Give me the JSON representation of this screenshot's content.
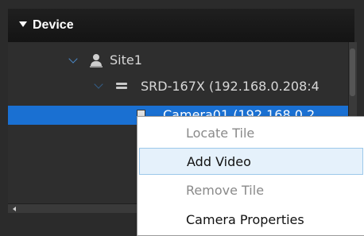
{
  "panel": {
    "title": "Device"
  },
  "tree": {
    "site": {
      "label": "Site1"
    },
    "recorder": {
      "label": "SRD-167X (192.168.0.208:4"
    },
    "camera": {
      "label": "Camera01 (192.168.0.2"
    }
  },
  "context_menu": {
    "items": [
      {
        "label": "Locate Tile",
        "enabled": false
      },
      {
        "label": "Add Video",
        "enabled": true,
        "highlighted": true
      },
      {
        "label": "Remove Tile",
        "enabled": false
      },
      {
        "label": "Camera Properties",
        "enabled": true
      }
    ]
  },
  "colors": {
    "selection": "#1a70d2",
    "menu_hover": "#e5f1fb",
    "tree_chevron": "#4a88c7"
  }
}
